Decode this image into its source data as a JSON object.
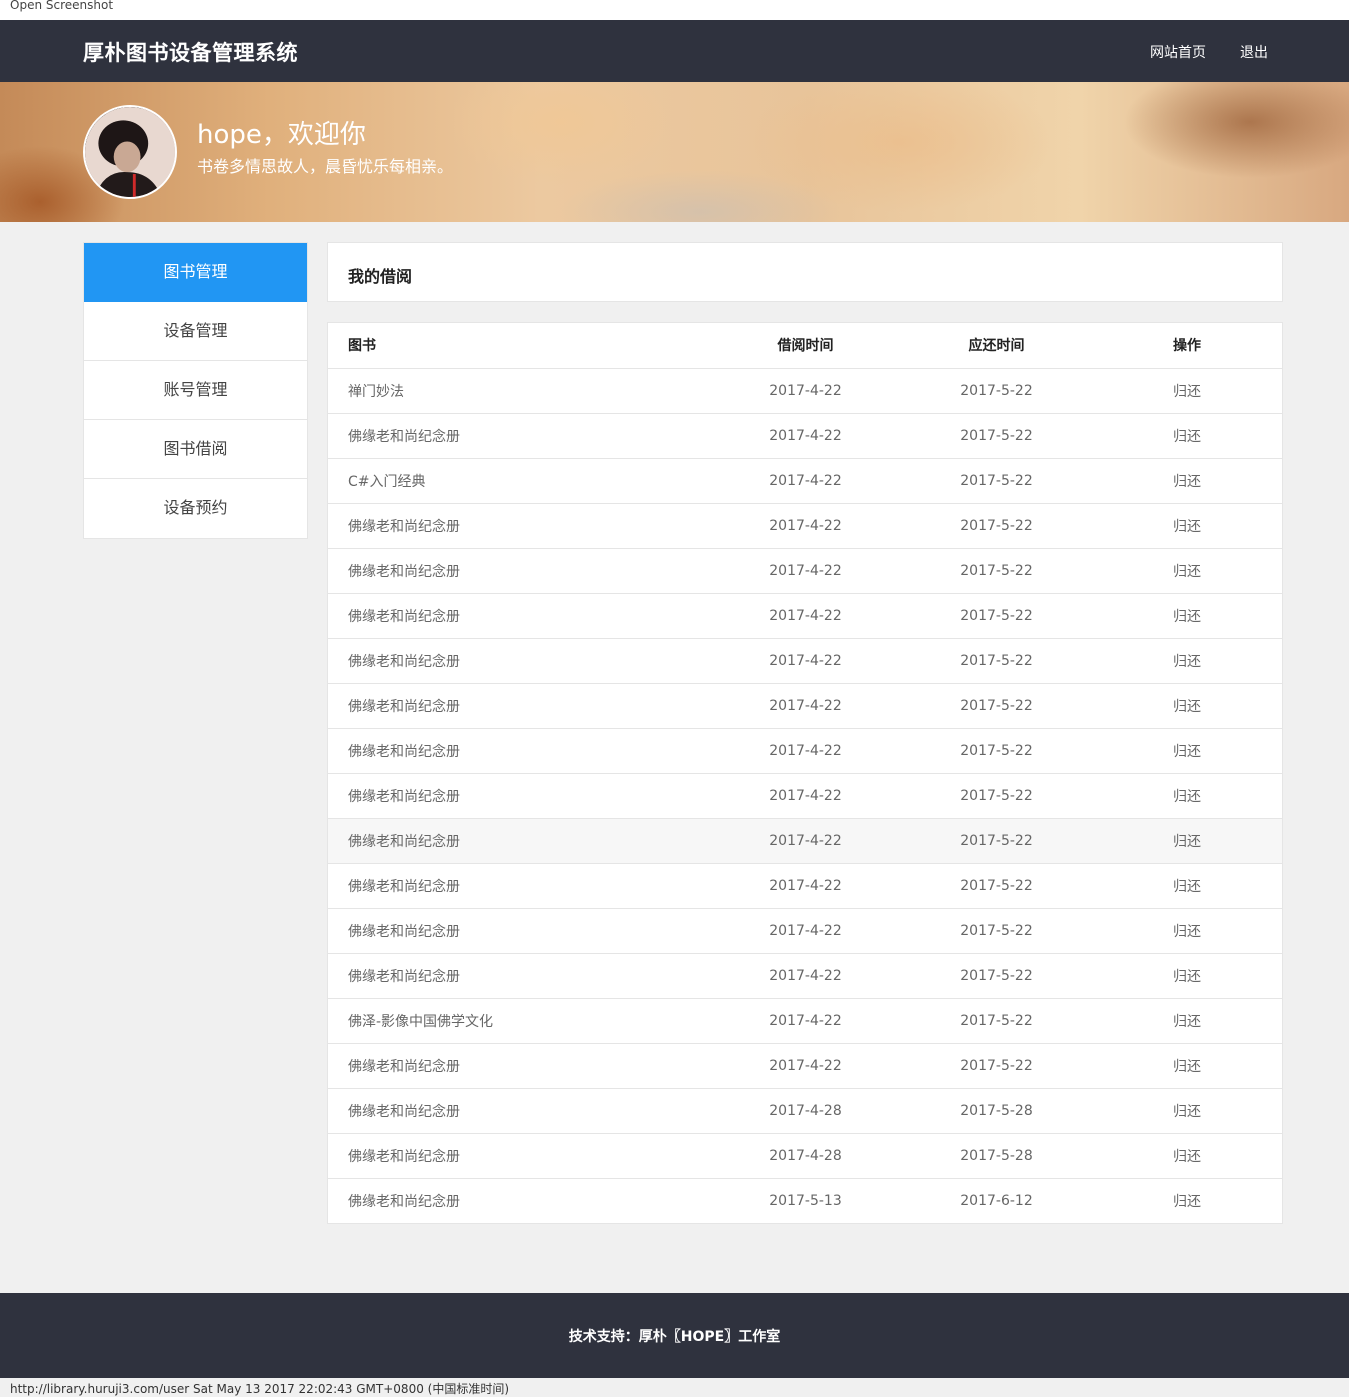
{
  "screenshot_label": "Open Screenshot",
  "header": {
    "brand": "厚朴图书设备管理系统",
    "nav": {
      "home": "网站首页",
      "logout": "退出"
    }
  },
  "banner": {
    "welcome": "hope，欢迎你",
    "motto": "书卷多情思故人，晨昏忧乐每相亲。"
  },
  "sidebar": {
    "items": [
      {
        "label": "图书管理",
        "active": true
      },
      {
        "label": "设备管理",
        "active": false
      },
      {
        "label": "账号管理",
        "active": false
      },
      {
        "label": "图书借阅",
        "active": false
      },
      {
        "label": "设备预约",
        "active": false
      }
    ]
  },
  "panel": {
    "title": "我的借阅"
  },
  "table": {
    "headers": {
      "book": "图书",
      "borrowed": "借阅时间",
      "due": "应还时间",
      "action": "操作"
    },
    "rows": [
      {
        "book": "禅门妙法",
        "borrowed": "2017-4-22",
        "due": "2017-5-22",
        "action": "归还"
      },
      {
        "book": "佛缘老和尚纪念册",
        "borrowed": "2017-4-22",
        "due": "2017-5-22",
        "action": "归还"
      },
      {
        "book": "C#入门经典",
        "borrowed": "2017-4-22",
        "due": "2017-5-22",
        "action": "归还"
      },
      {
        "book": "佛缘老和尚纪念册",
        "borrowed": "2017-4-22",
        "due": "2017-5-22",
        "action": "归还"
      },
      {
        "book": "佛缘老和尚纪念册",
        "borrowed": "2017-4-22",
        "due": "2017-5-22",
        "action": "归还"
      },
      {
        "book": "佛缘老和尚纪念册",
        "borrowed": "2017-4-22",
        "due": "2017-5-22",
        "action": "归还"
      },
      {
        "book": "佛缘老和尚纪念册",
        "borrowed": "2017-4-22",
        "due": "2017-5-22",
        "action": "归还"
      },
      {
        "book": "佛缘老和尚纪念册",
        "borrowed": "2017-4-22",
        "due": "2017-5-22",
        "action": "归还"
      },
      {
        "book": "佛缘老和尚纪念册",
        "borrowed": "2017-4-22",
        "due": "2017-5-22",
        "action": "归还"
      },
      {
        "book": "佛缘老和尚纪念册",
        "borrowed": "2017-4-22",
        "due": "2017-5-22",
        "action": "归还"
      },
      {
        "book": "佛缘老和尚纪念册",
        "borrowed": "2017-4-22",
        "due": "2017-5-22",
        "action": "归还",
        "highlighted": true
      },
      {
        "book": "佛缘老和尚纪念册",
        "borrowed": "2017-4-22",
        "due": "2017-5-22",
        "action": "归还"
      },
      {
        "book": "佛缘老和尚纪念册",
        "borrowed": "2017-4-22",
        "due": "2017-5-22",
        "action": "归还"
      },
      {
        "book": "佛缘老和尚纪念册",
        "borrowed": "2017-4-22",
        "due": "2017-5-22",
        "action": "归还"
      },
      {
        "book": "佛泽-影像中国佛学文化",
        "borrowed": "2017-4-22",
        "due": "2017-5-22",
        "action": "归还"
      },
      {
        "book": "佛缘老和尚纪念册",
        "borrowed": "2017-4-22",
        "due": "2017-5-22",
        "action": "归还"
      },
      {
        "book": "佛缘老和尚纪念册",
        "borrowed": "2017-4-28",
        "due": "2017-5-28",
        "action": "归还"
      },
      {
        "book": "佛缘老和尚纪念册",
        "borrowed": "2017-4-28",
        "due": "2017-5-28",
        "action": "归还"
      },
      {
        "book": "佛缘老和尚纪念册",
        "borrowed": "2017-5-13",
        "due": "2017-6-12",
        "action": "归还"
      }
    ]
  },
  "footer": {
    "text": "技术支持：厚朴〖HOPE〗工作室"
  },
  "status_line": "http://library.huruji3.com/user Sat May 13 2017 22:02:43 GMT+0800 (中国标准时间)",
  "colors": {
    "navbar": "#2f323e",
    "accent": "#2196f3",
    "page_bg": "#f0f0f0"
  }
}
